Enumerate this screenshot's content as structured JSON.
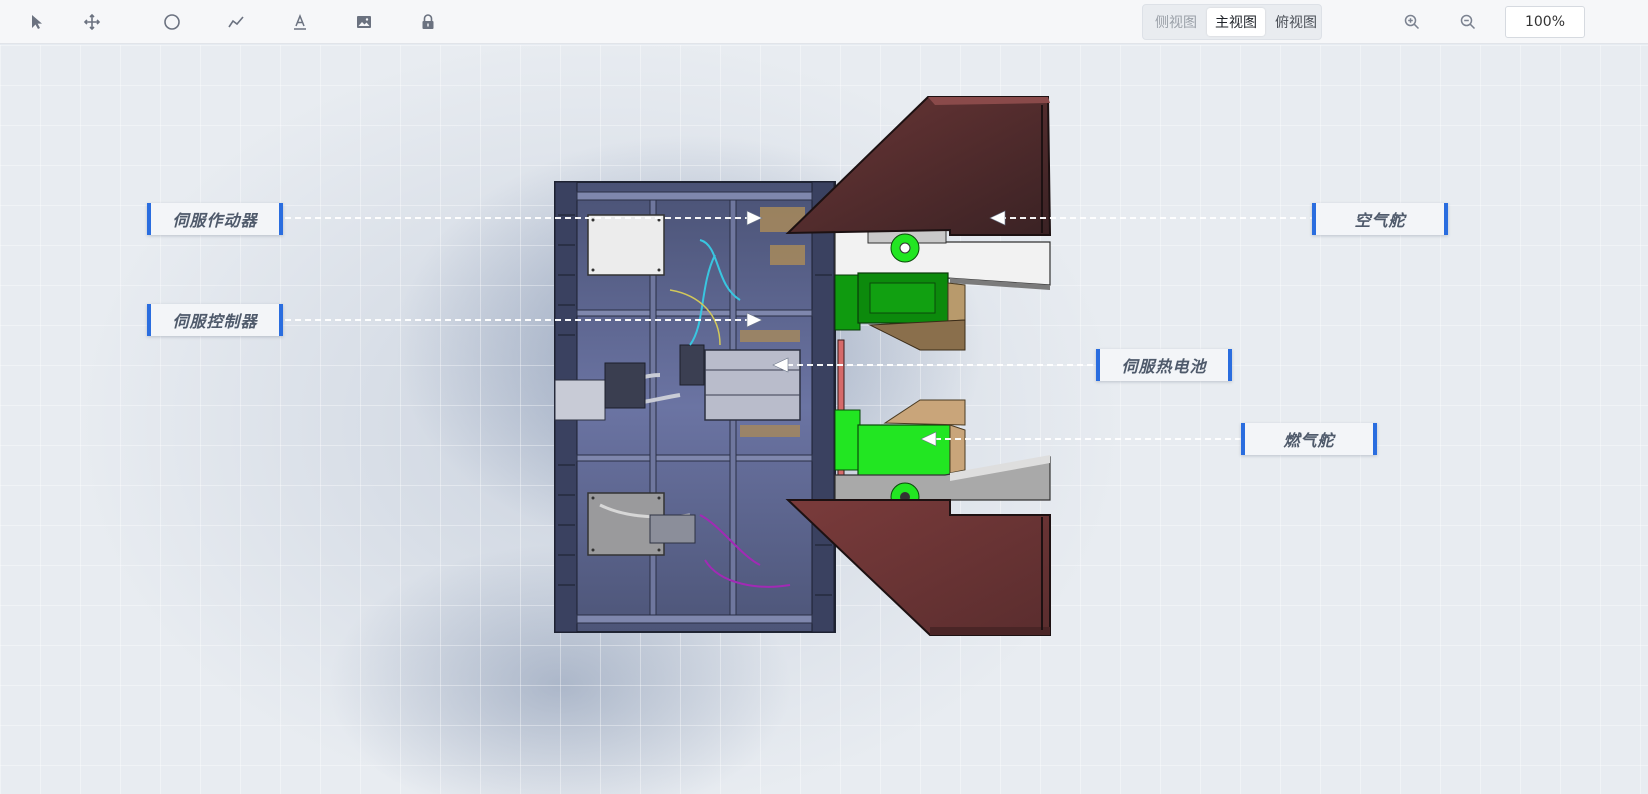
{
  "toolbar": {
    "tools": [
      {
        "name": "select-icon"
      },
      {
        "name": "move-icon"
      },
      {
        "name": "circle-icon"
      },
      {
        "name": "polyline-icon"
      },
      {
        "name": "text-icon"
      },
      {
        "name": "image-icon"
      },
      {
        "name": "lock-icon"
      }
    ],
    "views": {
      "side": "侧视图",
      "front": "主视图",
      "top": "俯视图",
      "active": "主视图"
    },
    "zoom_in": "zoom-in-icon",
    "zoom_out": "zoom-out-icon",
    "zoom_level": "100%"
  },
  "annotations": {
    "servo_actuator": "伺服作动器",
    "servo_controller": "伺服控制器",
    "air_rudder": "空气舵",
    "thermal_battery": "伺服热电池",
    "gas_rudder": "燃气舵"
  },
  "colors": {
    "accent": "#2a6ddf",
    "fin": "#6e3a3a",
    "fin_dark": "#3f2426",
    "green_bright": "#22e622",
    "green_dark": "#0c8a0c",
    "tan": "#b89a6c",
    "frame": "#5b6487"
  }
}
